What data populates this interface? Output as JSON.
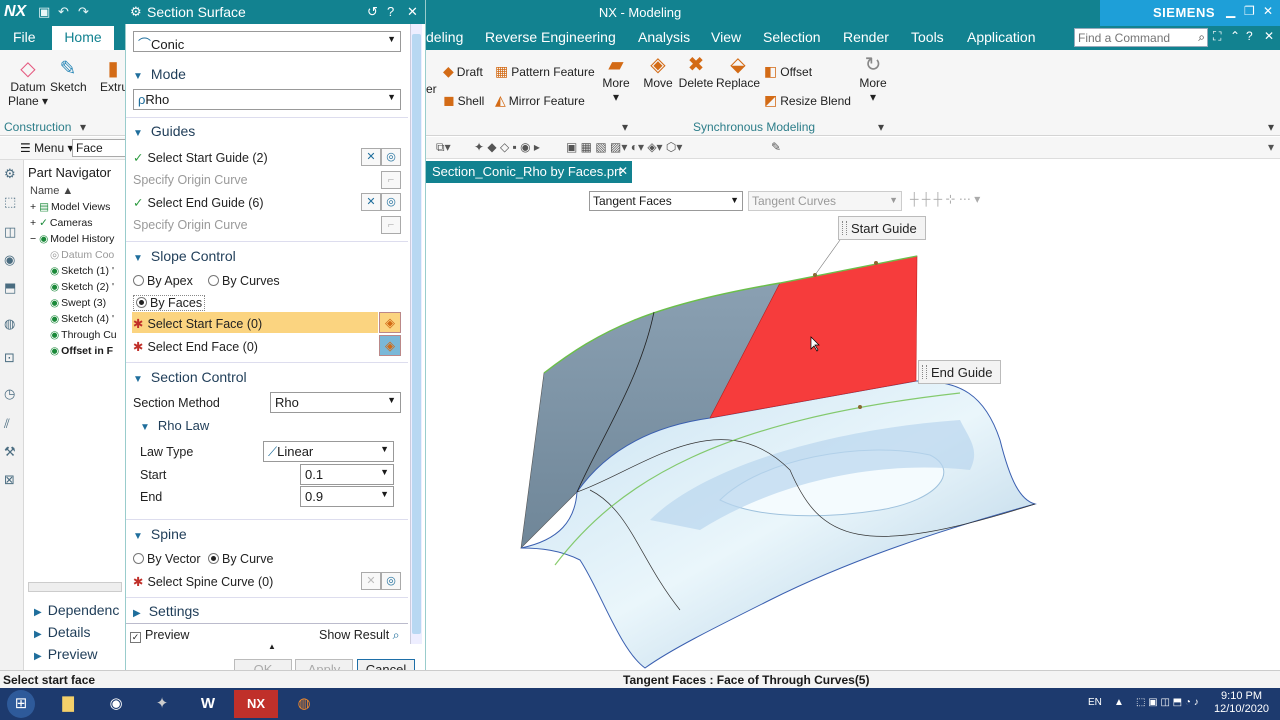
{
  "titlebar": {
    "logo": "NX",
    "title": "NX - Modeling",
    "brand": "SIEMENS"
  },
  "menubar": {
    "file": "File",
    "home": "Home",
    "tabs": [
      "deling",
      "Reverse Engineering",
      "Analysis",
      "View",
      "Selection",
      "Render",
      "Tools",
      "Application"
    ],
    "find_placeholder": "Find a Command"
  },
  "ribbon": {
    "datum_plane": "Datum Plane",
    "sketch": "Sketch",
    "extrude": "Extru",
    "construction": "Construction",
    "partial_er": "er",
    "draft": "Draft",
    "pattern_feature": "Pattern Feature",
    "shell": "Shell",
    "mirror_feature": "Mirror Feature",
    "more1": "More",
    "move": "Move",
    "delete": "Delete",
    "replace": "Replace",
    "offset": "Offset",
    "resize_blend": "Resize Blend",
    "more2": "More",
    "sync_group": "Synchronous Modeling"
  },
  "toolrow": {
    "menu": "Menu",
    "filter": "Face"
  },
  "partnav": {
    "title": "Part Navigator",
    "col_name": "Name",
    "items": [
      "Model Views",
      "Cameras",
      "Model History",
      "Datum Coo",
      "Sketch (1) '",
      "Sketch (2) '",
      "Swept (3)",
      "Sketch (4) '",
      "Through Cu",
      "Offset in F"
    ],
    "sections": [
      "Dependenc",
      "Details",
      "Preview"
    ]
  },
  "dialog": {
    "title": "Section Surface",
    "type_value": "Conic",
    "mode_head": "Mode",
    "mode_value": "Rho",
    "guides_head": "Guides",
    "select_start_guide": "Select Start Guide (2)",
    "specify_origin_1": "Specify Origin Curve",
    "select_end_guide": "Select End Guide (6)",
    "specify_origin_2": "Specify Origin Curve",
    "slope_head": "Slope Control",
    "by_apex": "By Apex",
    "by_curves": "By Curves",
    "by_faces": "By Faces",
    "select_start_face": "Select Start Face (0)",
    "select_end_face": "Select End Face (0)",
    "section_head": "Section Control",
    "section_method_label": "Section Method",
    "section_method_value": "Rho",
    "rho_law_head": "Rho Law",
    "law_type_label": "Law Type",
    "law_type_value": "Linear",
    "start_label": "Start",
    "start_value": "0.1",
    "end_label": "End",
    "end_value": "0.9",
    "spine_head": "Spine",
    "by_vector": "By Vector",
    "by_curve": "By Curve",
    "select_spine": "Select Spine Curve (0)",
    "settings_head": "Settings",
    "preview": "Preview",
    "show_result": "Show Result",
    "ok": "OK",
    "apply": "Apply",
    "cancel": "Cancel"
  },
  "graphics": {
    "tab": "Section_Conic_Rho by Faces.prt",
    "filter_primary": "Tangent Faces",
    "filter_secondary": "Tangent Curves",
    "tip_start": "Start Guide",
    "tip_end": "End Guide"
  },
  "status": {
    "left": "Select start face",
    "center": "Tangent Faces : Face of Through Curves(5)"
  },
  "taskbar": {
    "lang": "EN",
    "time": "9:10 PM",
    "date": "12/10/2020",
    "nx": "NX",
    "word": "W"
  },
  "colors": {
    "teal": "#128290",
    "siemens_blue": "#1e9fd8",
    "highlight": "#fbd480",
    "red_face": "#f63c3c"
  }
}
